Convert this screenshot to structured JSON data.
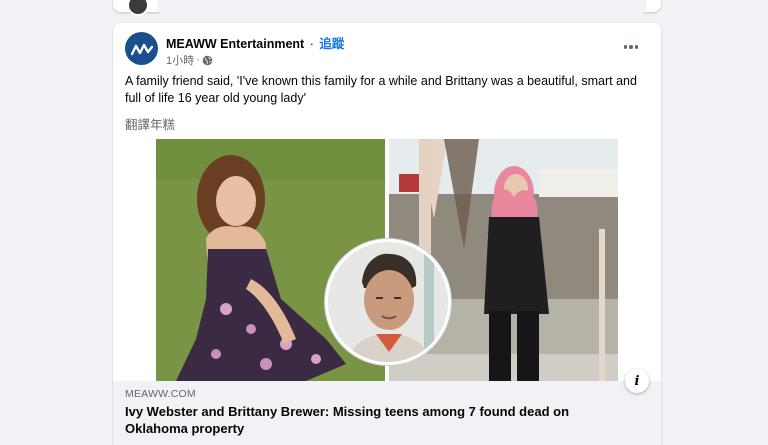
{
  "post": {
    "page_name": "MEAWW Entertainment",
    "separator": "·",
    "follow_label": "追蹤",
    "time_ago": "1小時",
    "meta_separator": "·",
    "privacy_icon": "globe-icon",
    "more_icon": "more-options-icon",
    "text": "A family friend said, 'I've known this family for a while and Brittany was a beautiful, smart and full of life 16 year old young lady'",
    "translate_label": "翻譯年糕"
  },
  "link": {
    "domain": "MEAWW.COM",
    "headline": "Ivy Webster and Brittany Brewer: Missing teens among 7 found dead on Oklahoma property",
    "info_icon": "info-icon"
  },
  "colors": {
    "accent": "#1877f2",
    "page_bg": "#f0f2f5",
    "card_bg": "#ffffff",
    "avatar_bg": "#1b4f8e"
  }
}
